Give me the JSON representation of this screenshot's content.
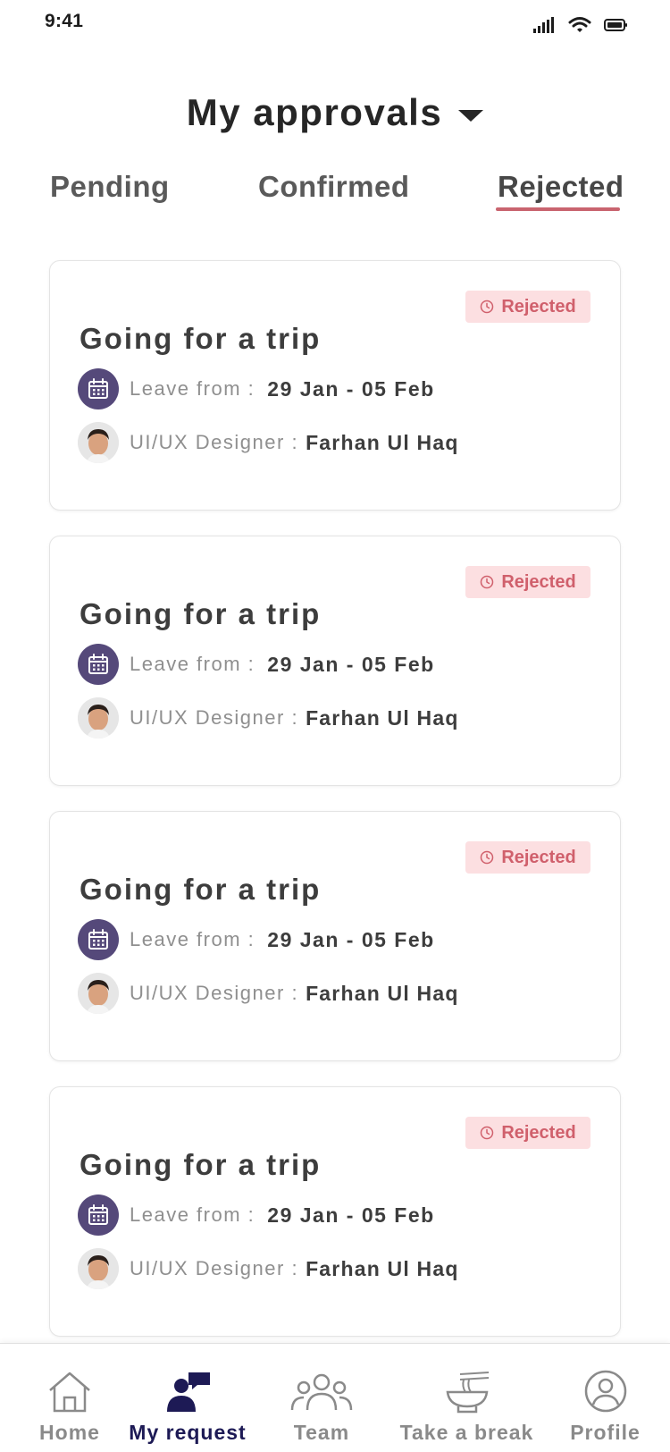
{
  "status_bar": {
    "time": "9:41"
  },
  "header": {
    "title": "My approvals"
  },
  "tabs": [
    {
      "label": "Pending"
    },
    {
      "label": "Confirmed"
    },
    {
      "label": "Rejected"
    }
  ],
  "active_tab": "Rejected",
  "requests": [
    {
      "status": "Rejected",
      "title": "Going for a trip",
      "leave_label": "Leave from :",
      "dates": "29 Jan - 05 Feb",
      "role_label": "UI/UX Designer :",
      "name": "Farhan Ul Haq"
    },
    {
      "status": "Rejected",
      "title": "Going for a trip",
      "leave_label": "Leave from :",
      "dates": "29 Jan - 05 Feb",
      "role_label": "UI/UX Designer :",
      "name": "Farhan Ul Haq"
    },
    {
      "status": "Rejected",
      "title": "Going for a trip",
      "leave_label": "Leave from :",
      "dates": "29 Jan - 05 Feb",
      "role_label": "UI/UX Designer :",
      "name": "Farhan Ul Haq"
    },
    {
      "status": "Rejected",
      "title": "Going for a trip",
      "leave_label": "Leave from :",
      "dates": "29 Jan - 05 Feb",
      "role_label": "UI/UX Designer :",
      "name": "Farhan Ul Haq"
    }
  ],
  "nav": [
    {
      "label": "Home",
      "icon": "home-icon"
    },
    {
      "label": "My request",
      "icon": "chat-person-icon"
    },
    {
      "label": "Team",
      "icon": "team-icon"
    },
    {
      "label": "Take a break",
      "icon": "noodle-bowl-icon"
    },
    {
      "label": "Profile",
      "icon": "profile-icon"
    }
  ],
  "active_nav": "My request",
  "colors": {
    "accent_underline": "#c9646f",
    "rejected_badge_bg": "#fcdfe1",
    "rejected_badge_text": "#d0606c",
    "calendar_circle": "#55497a",
    "nav_active": "#1d1a55",
    "nav_inactive": "#8a8a8a"
  }
}
